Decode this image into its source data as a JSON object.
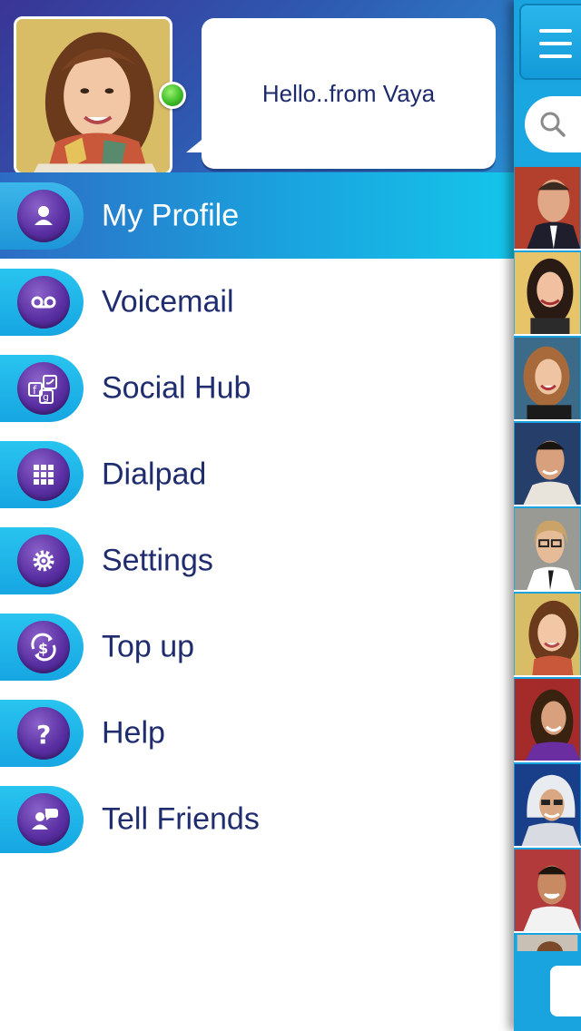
{
  "profile": {
    "status_message": "Hello..from Vaya",
    "online": true
  },
  "menu": {
    "items": [
      {
        "label": "My Profile",
        "icon": "person-icon",
        "active": true
      },
      {
        "label": "Voicemail",
        "icon": "voicemail-icon",
        "active": false
      },
      {
        "label": "Social Hub",
        "icon": "social-hub-icon",
        "active": false
      },
      {
        "label": "Dialpad",
        "icon": "dialpad-icon",
        "active": false
      },
      {
        "label": "Settings",
        "icon": "gear-icon",
        "active": false
      },
      {
        "label": "Top up",
        "icon": "dollar-refresh-icon",
        "active": false
      },
      {
        "label": "Help",
        "icon": "question-icon",
        "active": false
      },
      {
        "label": "Tell Friends",
        "icon": "tell-friends-icon",
        "active": false
      }
    ]
  },
  "main_panel": {
    "icons": [
      "hamburger-icon",
      "search-icon"
    ],
    "contacts_visible": 9
  },
  "colors": {
    "header_blue": "#3a3596",
    "accent_cyan": "#16a6e2",
    "orb_purple": "#5a2fa3",
    "label_navy": "#1f2c6e",
    "online_green": "#3fbd2a"
  }
}
